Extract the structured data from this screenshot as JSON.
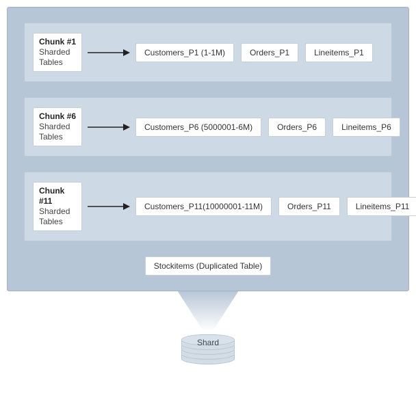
{
  "chunks": [
    {
      "title": "Chunk #1",
      "subtitle": "Sharded\nTables",
      "tables": [
        "Customers_P1 (1-1M)",
        "Orders_P1",
        "Lineitems_P1"
      ]
    },
    {
      "title": "Chunk #6",
      "subtitle": "Sharded\nTables",
      "tables": [
        "Customers_P6 (5000001-6M)",
        "Orders_P6",
        "Lineitems_P6"
      ]
    },
    {
      "title": "Chunk #11",
      "subtitle": "Sharded\nTables",
      "tables": [
        "Customers_P11(10000001-11M)",
        "Orders_P11",
        "Lineitems_P11"
      ]
    }
  ],
  "duplicated_table": "Stockitems (Duplicated Table)",
  "shard_label": "Shard"
}
